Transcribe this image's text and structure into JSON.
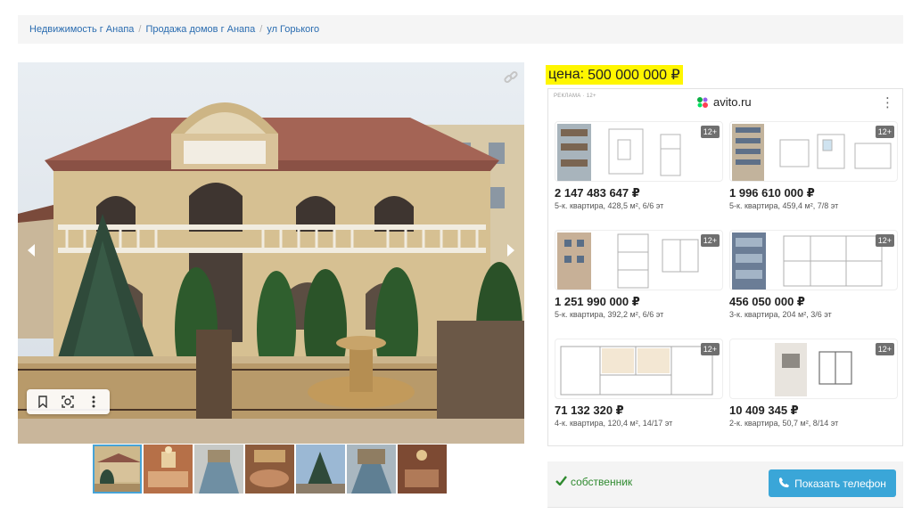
{
  "breadcrumb": [
    "Недвижимость г Анапа",
    "Продажа домов г Анапа",
    "ул Горького"
  ],
  "breadcrumb_sep": "/",
  "price": {
    "label": "цена:",
    "value": "500 000 000 ₽"
  },
  "ad": {
    "label": "РЕКЛАМА · 12+",
    "brand": "avito.ru",
    "menu_icon": "vertical-dots-icon",
    "cards": [
      {
        "price": "2 147 483 647 ₽",
        "desc": "5-к. квартира, 428,5 м², 6/6 эт",
        "badge": "12+"
      },
      {
        "price": "1 996 610 000 ₽",
        "desc": "5-к. квартира, 459,4 м², 7/8 эт",
        "badge": "12+"
      },
      {
        "price": "1 251 990 000 ₽",
        "desc": "5-к. квартира, 392,2 м², 6/6 эт",
        "badge": "12+"
      },
      {
        "price": "456 050 000 ₽",
        "desc": "3-к. квартира, 204 м², 3/6 эт",
        "badge": "12+"
      },
      {
        "price": "71 132 320 ₽",
        "desc": "4-к. квартира, 120,4 м², 14/17 эт",
        "badge": "12+"
      },
      {
        "price": "10 409 345 ₽",
        "desc": "2-к. квартира, 50,7 м², 8/14 эт",
        "badge": "12+"
      }
    ]
  },
  "owner_label": "собственник",
  "phone_button": "Показать телефон",
  "gallery": {
    "thumbnail_count": 7,
    "active_thumbnail": 1
  },
  "colors": {
    "link": "#2a6cb0",
    "highlight": "#fff600",
    "button": "#3aa6d8",
    "owner": "#2f8a2f"
  }
}
